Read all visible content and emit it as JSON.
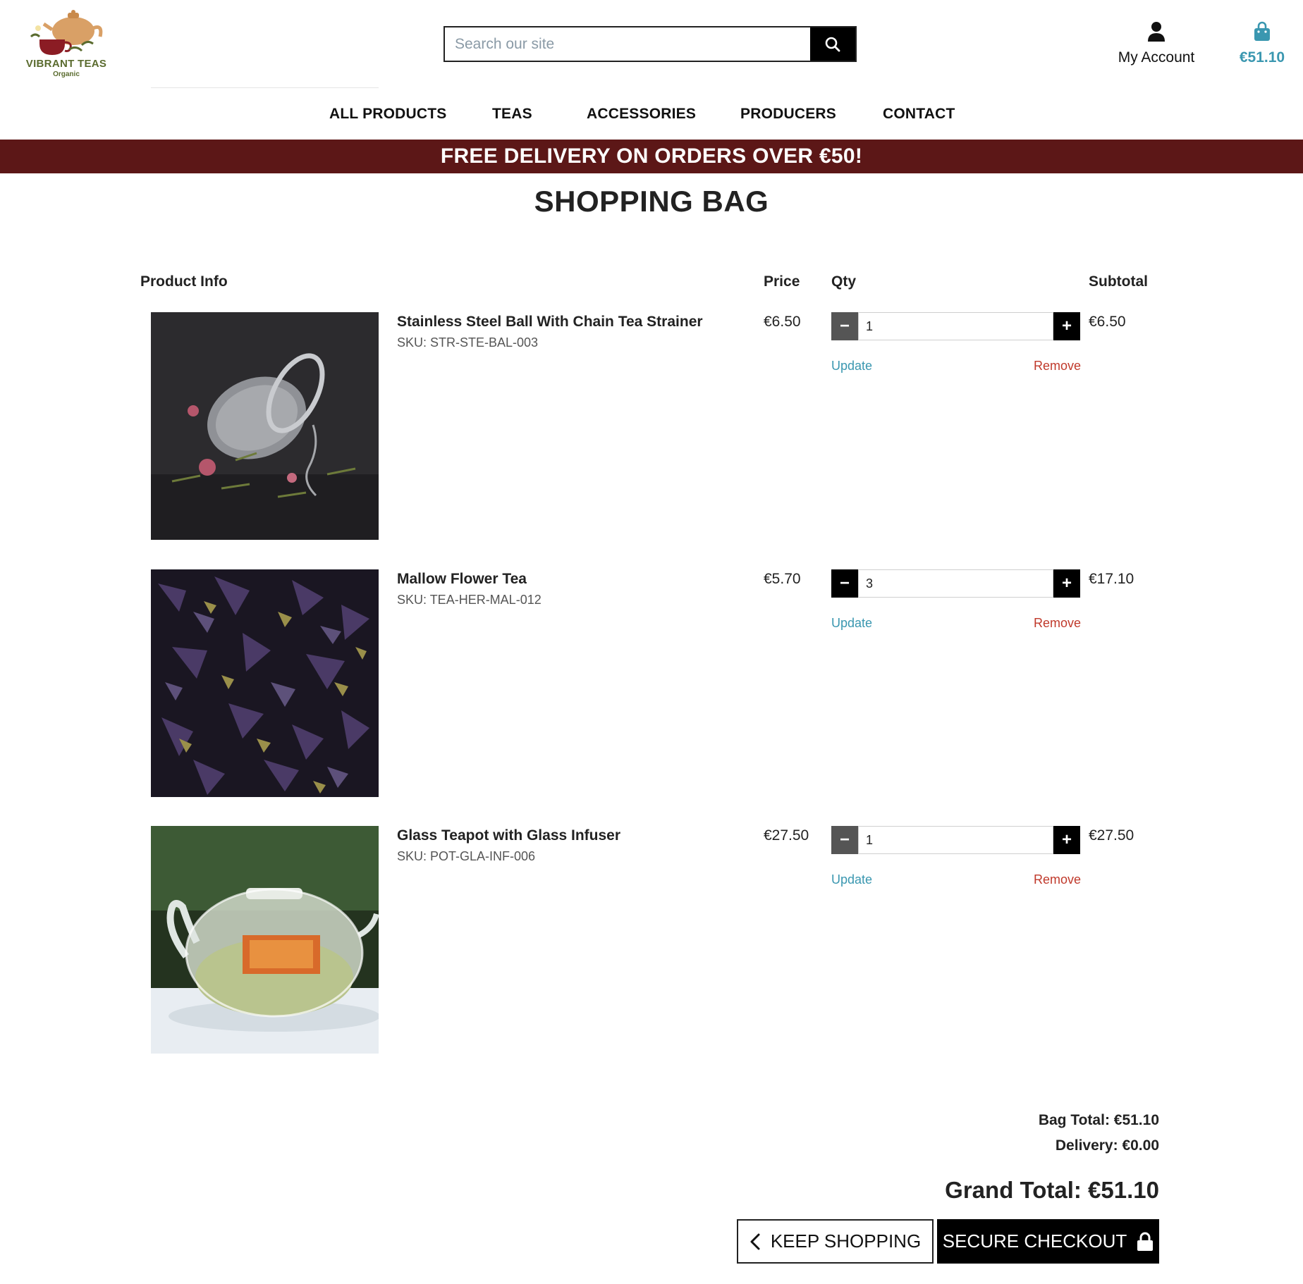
{
  "brand": {
    "name": "VIBRANT TEAS",
    "tagline": "Organic"
  },
  "search": {
    "placeholder": "Search our site"
  },
  "account": {
    "label": "My Account"
  },
  "bag": {
    "total": "€51.10"
  },
  "nav": [
    "ALL PRODUCTS",
    "TEAS",
    "ACCESSORIES",
    "PRODUCERS",
    "CONTACT"
  ],
  "banner": "FREE DELIVERY ON ORDERS OVER €50!",
  "page_title": "SHOPPING BAG",
  "columns": {
    "product": "Product Info",
    "price": "Price",
    "qty": "Qty",
    "subtotal": "Subtotal"
  },
  "items": [
    {
      "name": "Stainless Steel Ball With Chain Tea Strainer",
      "sku": "SKU: STR-STE-BAL-003",
      "price": "€6.50",
      "qty": "1",
      "subtotal": "€6.50",
      "update": "Update",
      "remove": "Remove"
    },
    {
      "name": "Mallow Flower Tea",
      "sku": "SKU: TEA-HER-MAL-012",
      "price": "€5.70",
      "qty": "3",
      "subtotal": "€17.10",
      "update": "Update",
      "remove": "Remove"
    },
    {
      "name": "Glass Teapot with Glass Infuser",
      "sku": "SKU: POT-GLA-INF-006",
      "price": "€27.50",
      "qty": "1",
      "subtotal": "€27.50",
      "update": "Update",
      "remove": "Remove"
    }
  ],
  "totals": {
    "bag_total": "Bag Total: €51.10",
    "delivery": "Delivery: €0.00",
    "grand_total": "Grand Total: €51.10"
  },
  "buttons": {
    "keep_shopping": "KEEP SHOPPING",
    "checkout": "SECURE CHECKOUT"
  },
  "colors": {
    "banner": "#5c1717",
    "accent": "#3a97b0",
    "remove": "#c0392b"
  }
}
